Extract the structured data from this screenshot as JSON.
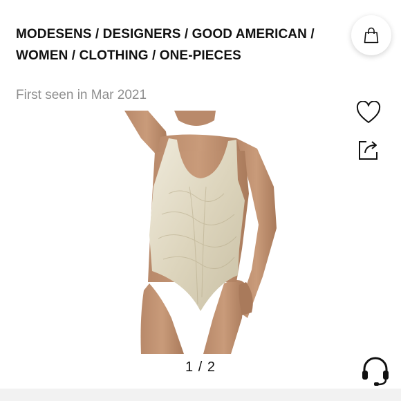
{
  "breadcrumb": {
    "line1": "MODESENS / DESIGNERS / GOOD AMERICAN /",
    "line2": "WOMEN / CLOTHING / ONE-PIECES"
  },
  "product": {
    "first_seen": "First seen in Mar 2021",
    "pager": "1 / 2"
  },
  "icons": {
    "bag": "shopping-bag-icon",
    "wishlist": "heart-icon",
    "share": "share-icon",
    "support": "headset-icon"
  },
  "colors": {
    "text": "#111111",
    "muted": "#8e8e8e",
    "swimsuit": "#e6e0cc"
  }
}
